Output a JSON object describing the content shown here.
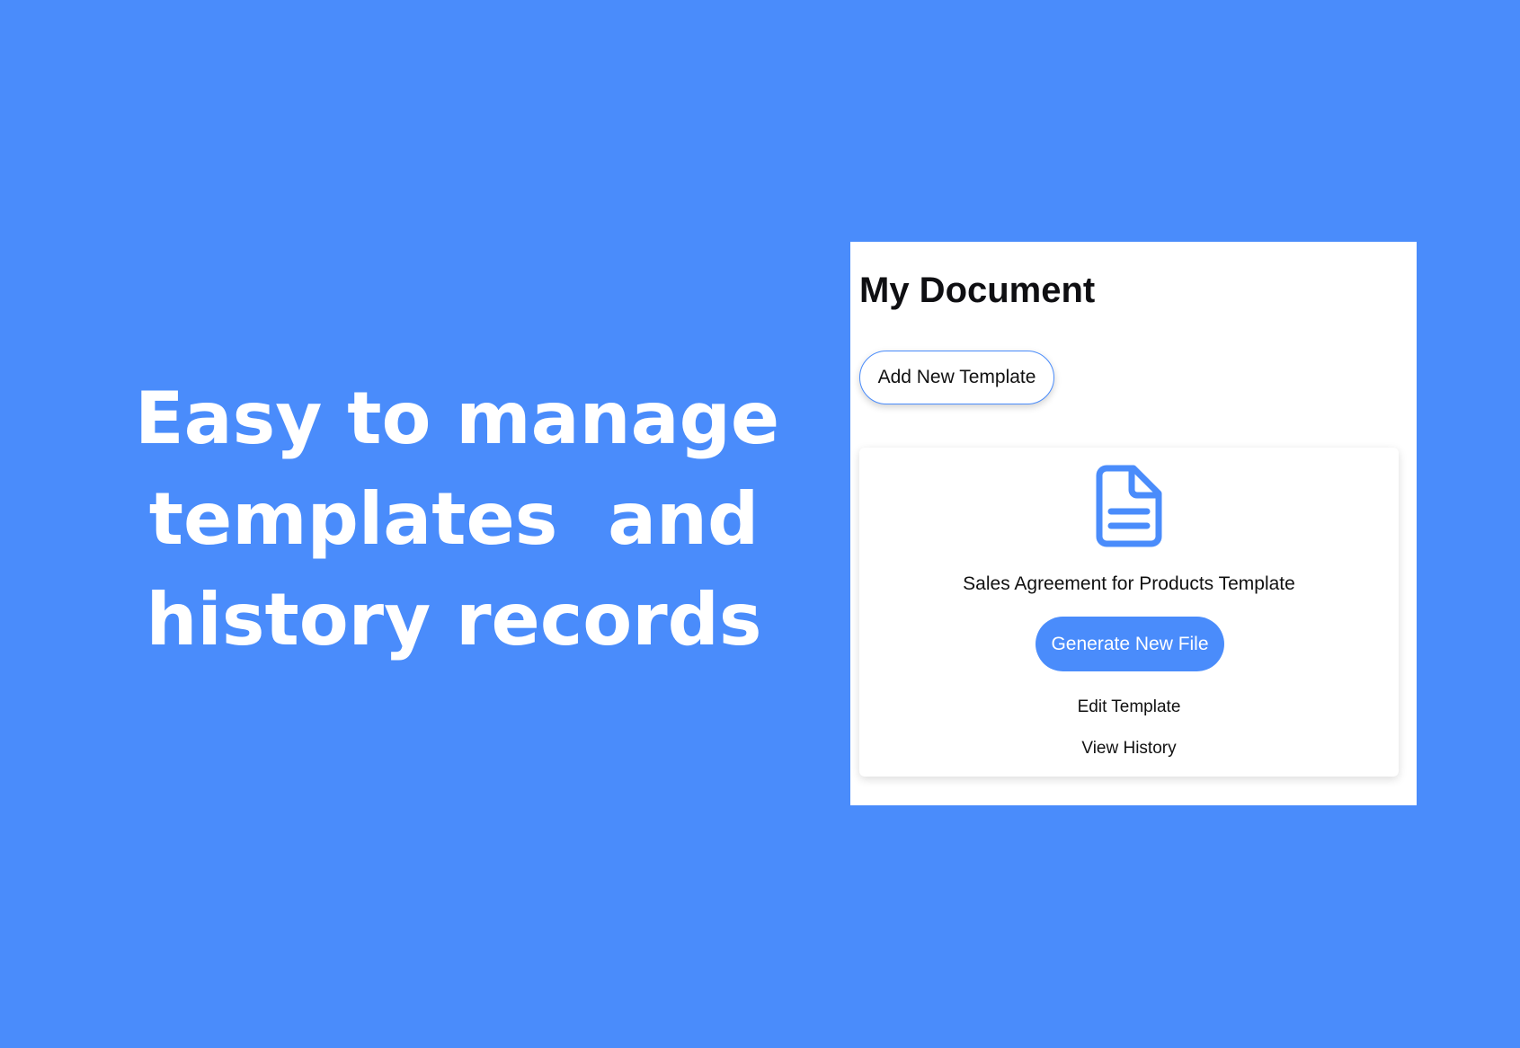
{
  "headline": {
    "line1": "Easy to manage",
    "line2": "templates  and",
    "line3": "history records"
  },
  "panel": {
    "title": "My Document",
    "add_button_label": "Add New Template",
    "card": {
      "icon": "document-icon",
      "title": "Sales Agreement for Products Template",
      "generate_button_label": "Generate New File",
      "edit_link_label": "Edit Template",
      "history_link_label": "View History"
    }
  },
  "colors": {
    "background": "#4a8cfb",
    "accent": "#4a8cfb",
    "panel": "#ffffff"
  }
}
